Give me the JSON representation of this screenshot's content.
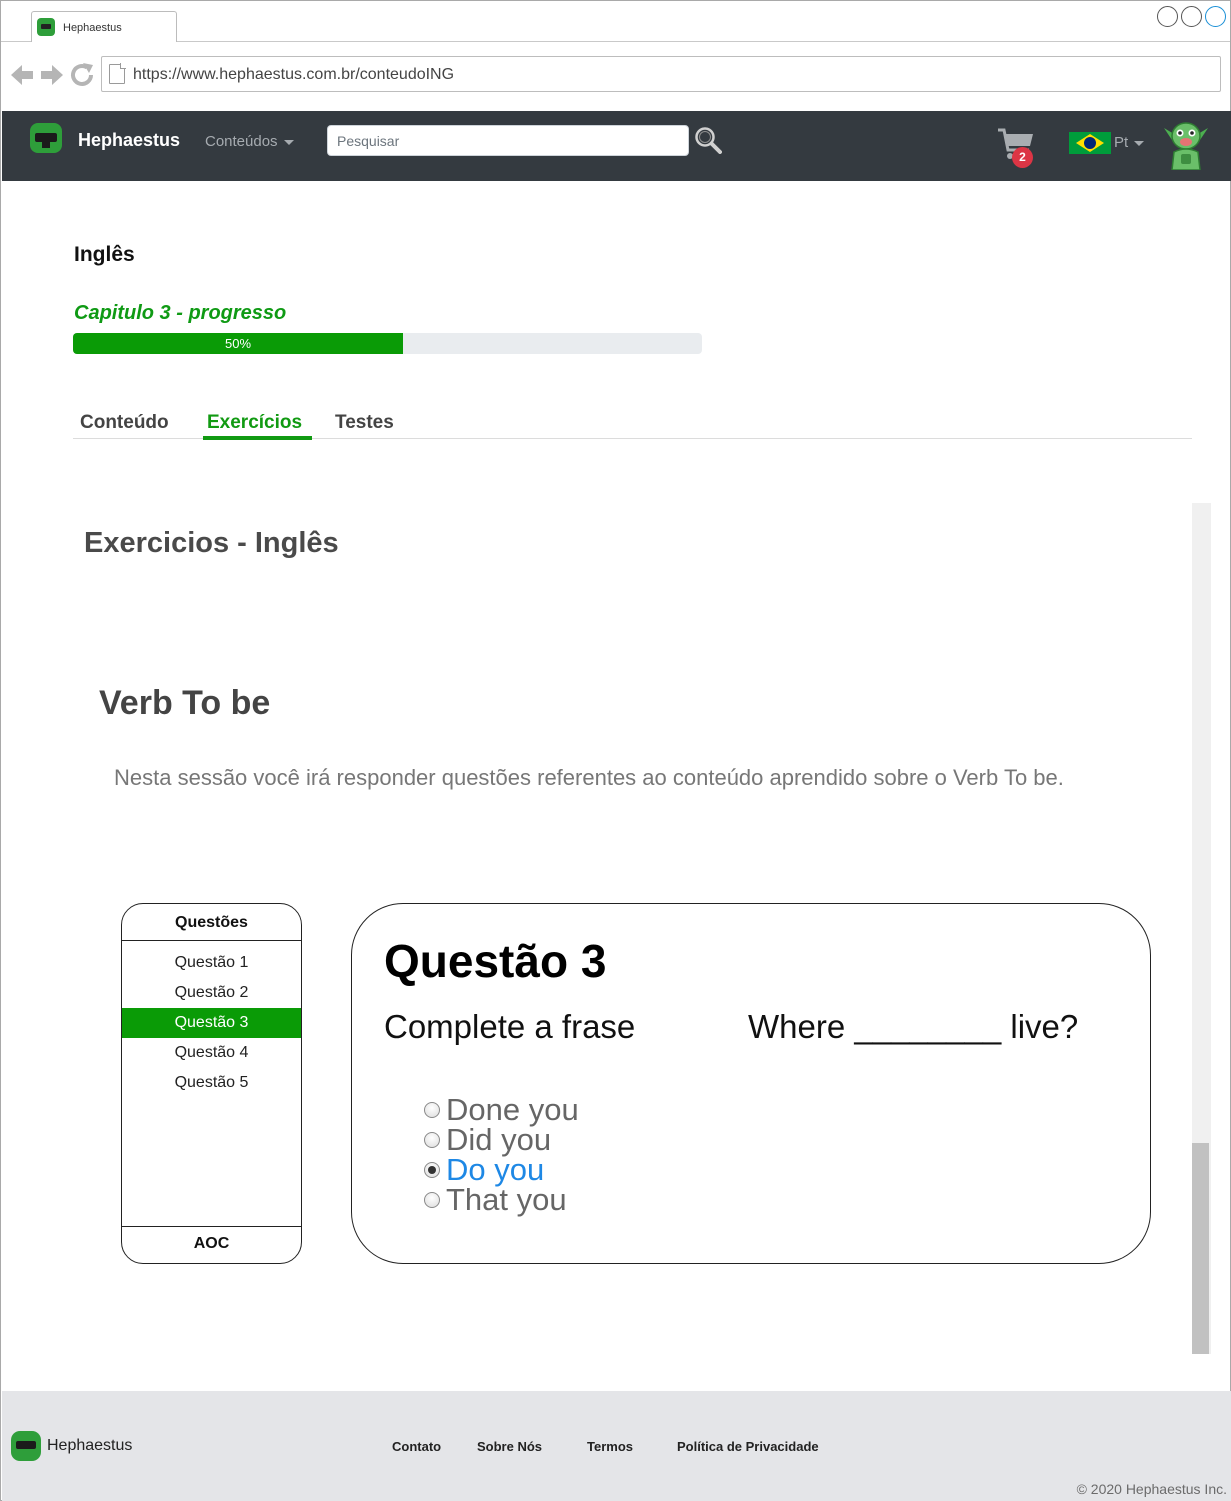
{
  "browser": {
    "tab_title": "Hephaestus",
    "url": "https://www.hephaestus.com.br/conteudoING"
  },
  "navbar": {
    "brand": "Hephaestus",
    "menu_label": "Conteúdos",
    "search_placeholder": "Pesquisar",
    "cart_count": "2",
    "language": "Pt"
  },
  "course": {
    "title": "Inglês",
    "progress_label": "Capitulo 3 - progresso",
    "progress_percent": 50,
    "progress_text": "50%"
  },
  "tabs": [
    {
      "label": "Conteúdo",
      "active": false
    },
    {
      "label": "Exercícios",
      "active": true
    },
    {
      "label": "Testes",
      "active": false
    }
  ],
  "exercises": {
    "title": "Exercicios - Inglês",
    "section_title": "Verb To be",
    "description": "Nesta sessão você irá responder questões referentes ao conteúdo aprendido sobre o Verb To be."
  },
  "questions_panel": {
    "header": "Questões",
    "items": [
      "Questão 1",
      "Questão 2",
      "Questão 3",
      "Questão 4",
      "Questão 5"
    ],
    "active_index": 2,
    "footer": "AOC"
  },
  "question": {
    "title": "Questão 3",
    "prompt": "Complete a frase",
    "sentence": "Where ________ live?",
    "options": [
      "Done you",
      "Did you",
      "Do you",
      "That you"
    ],
    "selected_index": 2
  },
  "footer": {
    "brand": "Hephaestus",
    "links": [
      "Contato",
      "Sobre Nós",
      "Termos",
      "Política de Privacidade"
    ],
    "copyright": "© 2020 Hephaestus Inc."
  },
  "colors": {
    "accent_green": "#0a9b06",
    "navbar_bg": "#343a40",
    "badge_red": "#dc3545",
    "selected_blue": "#1e88e5"
  }
}
